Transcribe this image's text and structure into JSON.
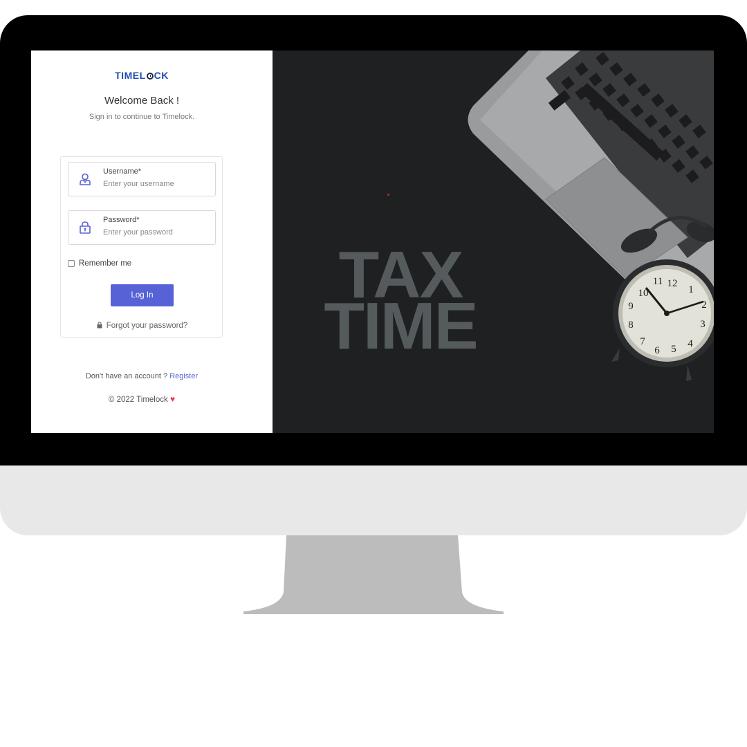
{
  "brand": {
    "logo_prefix": "TIMEL",
    "logo_suffix": "CK"
  },
  "login": {
    "welcome": "Welcome Back !",
    "subtitle": "Sign in to continue to Timelock.",
    "username_label": "Username*",
    "username_placeholder": "Enter your username",
    "password_label": "Password*",
    "password_placeholder": "Enter your password",
    "remember_label": "Remember me",
    "login_button": "Log In",
    "forgot_link": "Forgot your password?"
  },
  "footer": {
    "no_account": "Don't have an account ?",
    "register_link": "Register",
    "copyright": "© 2022 Timelock"
  },
  "hero": {
    "line1": "TAX",
    "line2": "TIME"
  },
  "colors": {
    "brand_blue": "#1f4db1",
    "button": "#5762d6",
    "heart": "#ee3a57"
  },
  "icons": [
    "user-icon",
    "lock-icon",
    "heart-icon",
    "laptop-icon",
    "alarm-clock-icon"
  ]
}
